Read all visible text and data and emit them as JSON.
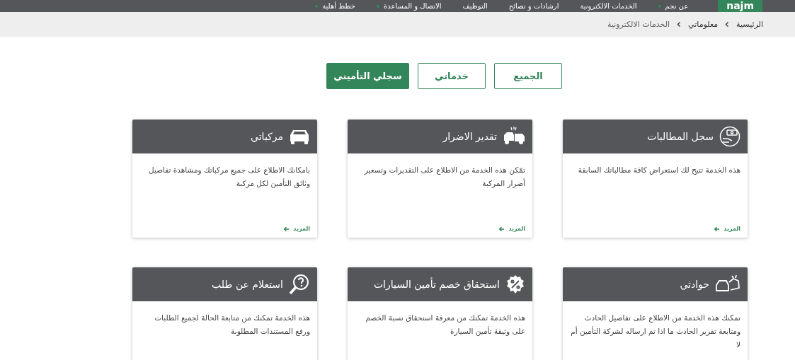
{
  "nav": {
    "logo": "najm",
    "items": [
      {
        "label": "عن نجم",
        "has_menu": true
      },
      {
        "label": "الخدمات الالكترونية",
        "has_menu": false
      },
      {
        "label": "ارشادات و نصائح",
        "has_menu": false
      },
      {
        "label": "التوظيف",
        "has_menu": false
      },
      {
        "label": "الاتصال و المساعدة",
        "has_menu": true
      },
      {
        "label": "خطط أهلية",
        "has_menu": true
      }
    ]
  },
  "breadcrumb": [
    {
      "label": "الرئيسية",
      "kind": "link"
    },
    {
      "label": "معلوماتي",
      "kind": "link"
    },
    {
      "label": "الخدمات الالكترونية",
      "kind": "current"
    }
  ],
  "filters": [
    {
      "label": "الجميع",
      "selected": false
    },
    {
      "label": "خدماتي",
      "selected": false
    },
    {
      "label": "سجلي التأميني",
      "selected": true
    }
  ],
  "cards": [
    {
      "title": "سجل المطالبات",
      "description": "هذه الخدمة تتيح لك استعراض كافة مطالباتك السابقة",
      "more": "المزيد"
    },
    {
      "title": "تقدير الاضرار",
      "description": "تمّكن هذه الخدمة من الاطلاع على التقديرات وتسعير أضرار المركبة",
      "more": "المزيد"
    },
    {
      "title": "مركباتي",
      "description": "بامكانك الاطلاع على جميع مركباتك ومشاهدة تفاصيل وثائق التأمين لكل مركبة",
      "more": "المزيد"
    },
    {
      "title": "حوادثي",
      "description": "تمكنك هذه الخدمة من الاطلاع على تفاصيل الحادث ومتابعة تقرير الحادث ما اذا تم ارساله لشركة التأمين أم لا"
    },
    {
      "title": "استحقاق خصم تأمين السيارات",
      "description": "هذه الخدمة تمكنك من معرفة استحقاق نسبة الخصم على وثيقة تأمين السيارة"
    },
    {
      "title": "استعلام عن طلب",
      "description": "هذه الخدمة تمكنك من متابعة الحالة لجميع الطلبات ورفع المستندات المطلوبة"
    }
  ]
}
